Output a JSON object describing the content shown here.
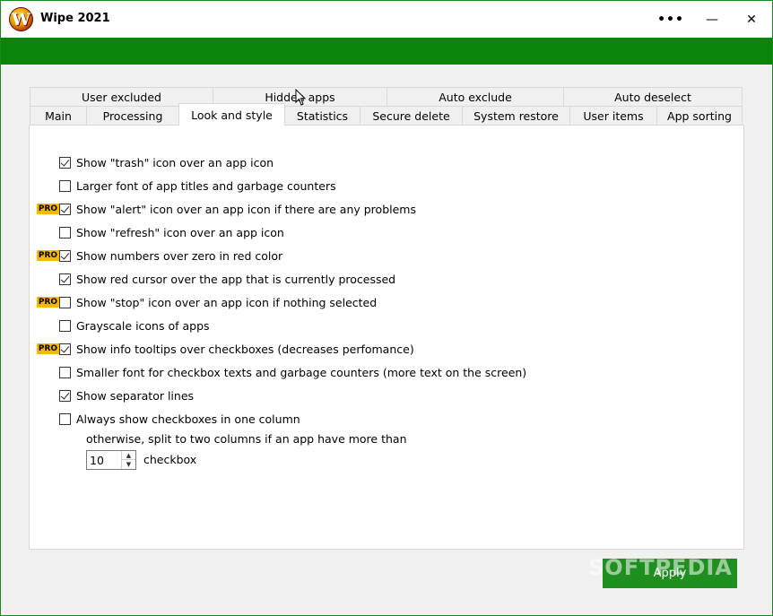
{
  "window": {
    "title": "Wipe 2021",
    "logo_letter": "W",
    "more_glyph": "•••",
    "minimize_glyph": "—",
    "close_glyph": "✕"
  },
  "tabs_row1": [
    "User excluded",
    "Hidden apps",
    "Auto exclude",
    "Auto deselect"
  ],
  "tabs_row2": [
    "Main",
    "Processing",
    "Look and style",
    "Statistics",
    "Secure delete",
    "System restore",
    "User items",
    "App sorting"
  ],
  "active_tab": "Look and style",
  "pro_badge": "PRO",
  "options": [
    {
      "label": "Show \"trash\" icon over an app icon",
      "checked": true,
      "pro": false
    },
    {
      "label": "Larger font of app titles and garbage counters",
      "checked": false,
      "pro": false
    },
    {
      "label": "Show \"alert\" icon over an app icon if there are any problems",
      "checked": true,
      "pro": true
    },
    {
      "label": "Show \"refresh\" icon over an app icon",
      "checked": false,
      "pro": false
    },
    {
      "label": "Show numbers over zero in red color",
      "checked": true,
      "pro": true
    },
    {
      "label": "Show red cursor over the app that is currently processed",
      "checked": true,
      "pro": false
    },
    {
      "label": "Show \"stop\" icon over an app icon if nothing selected",
      "checked": false,
      "pro": true
    },
    {
      "label": "Grayscale icons of apps",
      "checked": false,
      "pro": false
    },
    {
      "label": "Show info tooltips over checkboxes (decreases perfomance)",
      "checked": true,
      "pro": true
    },
    {
      "label": "Smaller font for checkbox texts and garbage counters (more text on the screen)",
      "checked": false,
      "pro": false
    },
    {
      "label": "Show separator lines",
      "checked": true,
      "pro": false
    },
    {
      "label": "Always show checkboxes in one column",
      "checked": false,
      "pro": false
    }
  ],
  "column_note": "otherwise, split to two columns if an app have more than",
  "column_threshold": {
    "value": "10",
    "suffix": "checkbox"
  },
  "apply_label": "Apply",
  "watermark": "SOFTPEDIA",
  "colors": {
    "green": "#0a840a",
    "pro_badge": "#f4b800"
  }
}
